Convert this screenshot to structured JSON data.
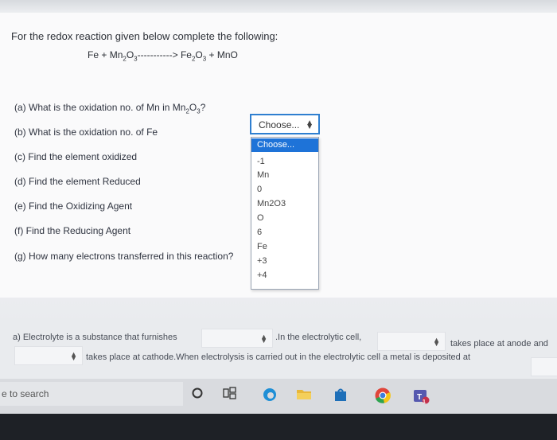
{
  "question": {
    "title": "For the redox reaction given below complete the following:",
    "equation": {
      "fe": "Fe +",
      "mn": "Mn",
      "mn_sub2": "2",
      "o": "O",
      "o_sub3": "3",
      "arrow": "----------->",
      "fe2": "Fe",
      "fe_sub2": "2",
      "o2": "O",
      "o2_sub3": "3",
      "plus_mno": "+ MnO"
    },
    "items": [
      {
        "text": "(a) What is the oxidation no. of Mn in Mn",
        "sub": "2",
        "text2": "O",
        "sub2": "3",
        "text3": "?"
      },
      {
        "text": "(b) What is the oxidation no. of Fe"
      },
      {
        "text": "(c) Find the element oxidized"
      },
      {
        "text": "(d) Find the element Reduced"
      },
      {
        "text": "(e) Find the Oxidizing Agent"
      },
      {
        "text": "(f)  Find the Reducing Agent"
      },
      {
        "text": "(g) How many electrons transferred in this reaction?"
      }
    ],
    "select_value": "Choose...",
    "dropdown_options": [
      "Choose...",
      "-1",
      "Mn",
      "0",
      "Mn2O3",
      "O",
      "6",
      "Fe",
      "+3",
      "+4"
    ]
  },
  "lower": {
    "line1_a": "a) Electrolyte is a substance that furnishes",
    "line1_b": ".In the electrolytic cell,",
    "line1_c": "takes place at anode and",
    "line2_a": "takes place at cathode.When electrolysis is carried out in the electrolytic cell a metal is deposited at"
  },
  "taskbar": {
    "search_text": "e to search",
    "icons": [
      "cortana-icon",
      "task-view-icon",
      "edge-icon",
      "file-explorer-icon",
      "store-icon",
      "chrome-icon",
      "teams-icon"
    ],
    "teams_badge": "1"
  },
  "colors": {
    "select_border": "#2f7fd0",
    "selected_option": "#1e73d8",
    "edge": "#1f8fd6",
    "chrome": "#e0463b",
    "teams": "#5558af"
  }
}
